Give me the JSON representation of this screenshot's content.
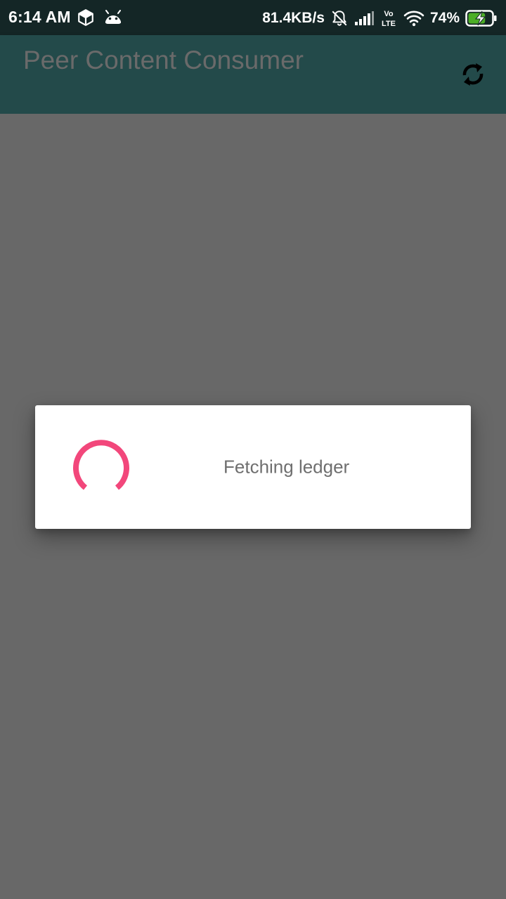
{
  "status_bar": {
    "time": "6:14 AM",
    "left_icons": [
      "package-icon",
      "android-icon"
    ],
    "network_speed": "81.4KB/s",
    "right_icons": [
      "bell-off-icon",
      "signal-icon",
      "volte-icon",
      "wifi-icon"
    ],
    "volte_top": "Vo",
    "volte_bottom": "LTE",
    "battery_percent": "74%",
    "battery_level": 0.74,
    "battery_charging": true
  },
  "app_bar": {
    "title": "Peer Content Consumer",
    "action_icon": "refresh-icon"
  },
  "dialog": {
    "message": "Fetching ledger",
    "spinner_color": "#f2477b"
  },
  "colors": {
    "status_bar_bg": "#142626",
    "app_bar_bg": "#234a4a",
    "scrim": "#686868",
    "battery_fill": "#4caf27"
  }
}
